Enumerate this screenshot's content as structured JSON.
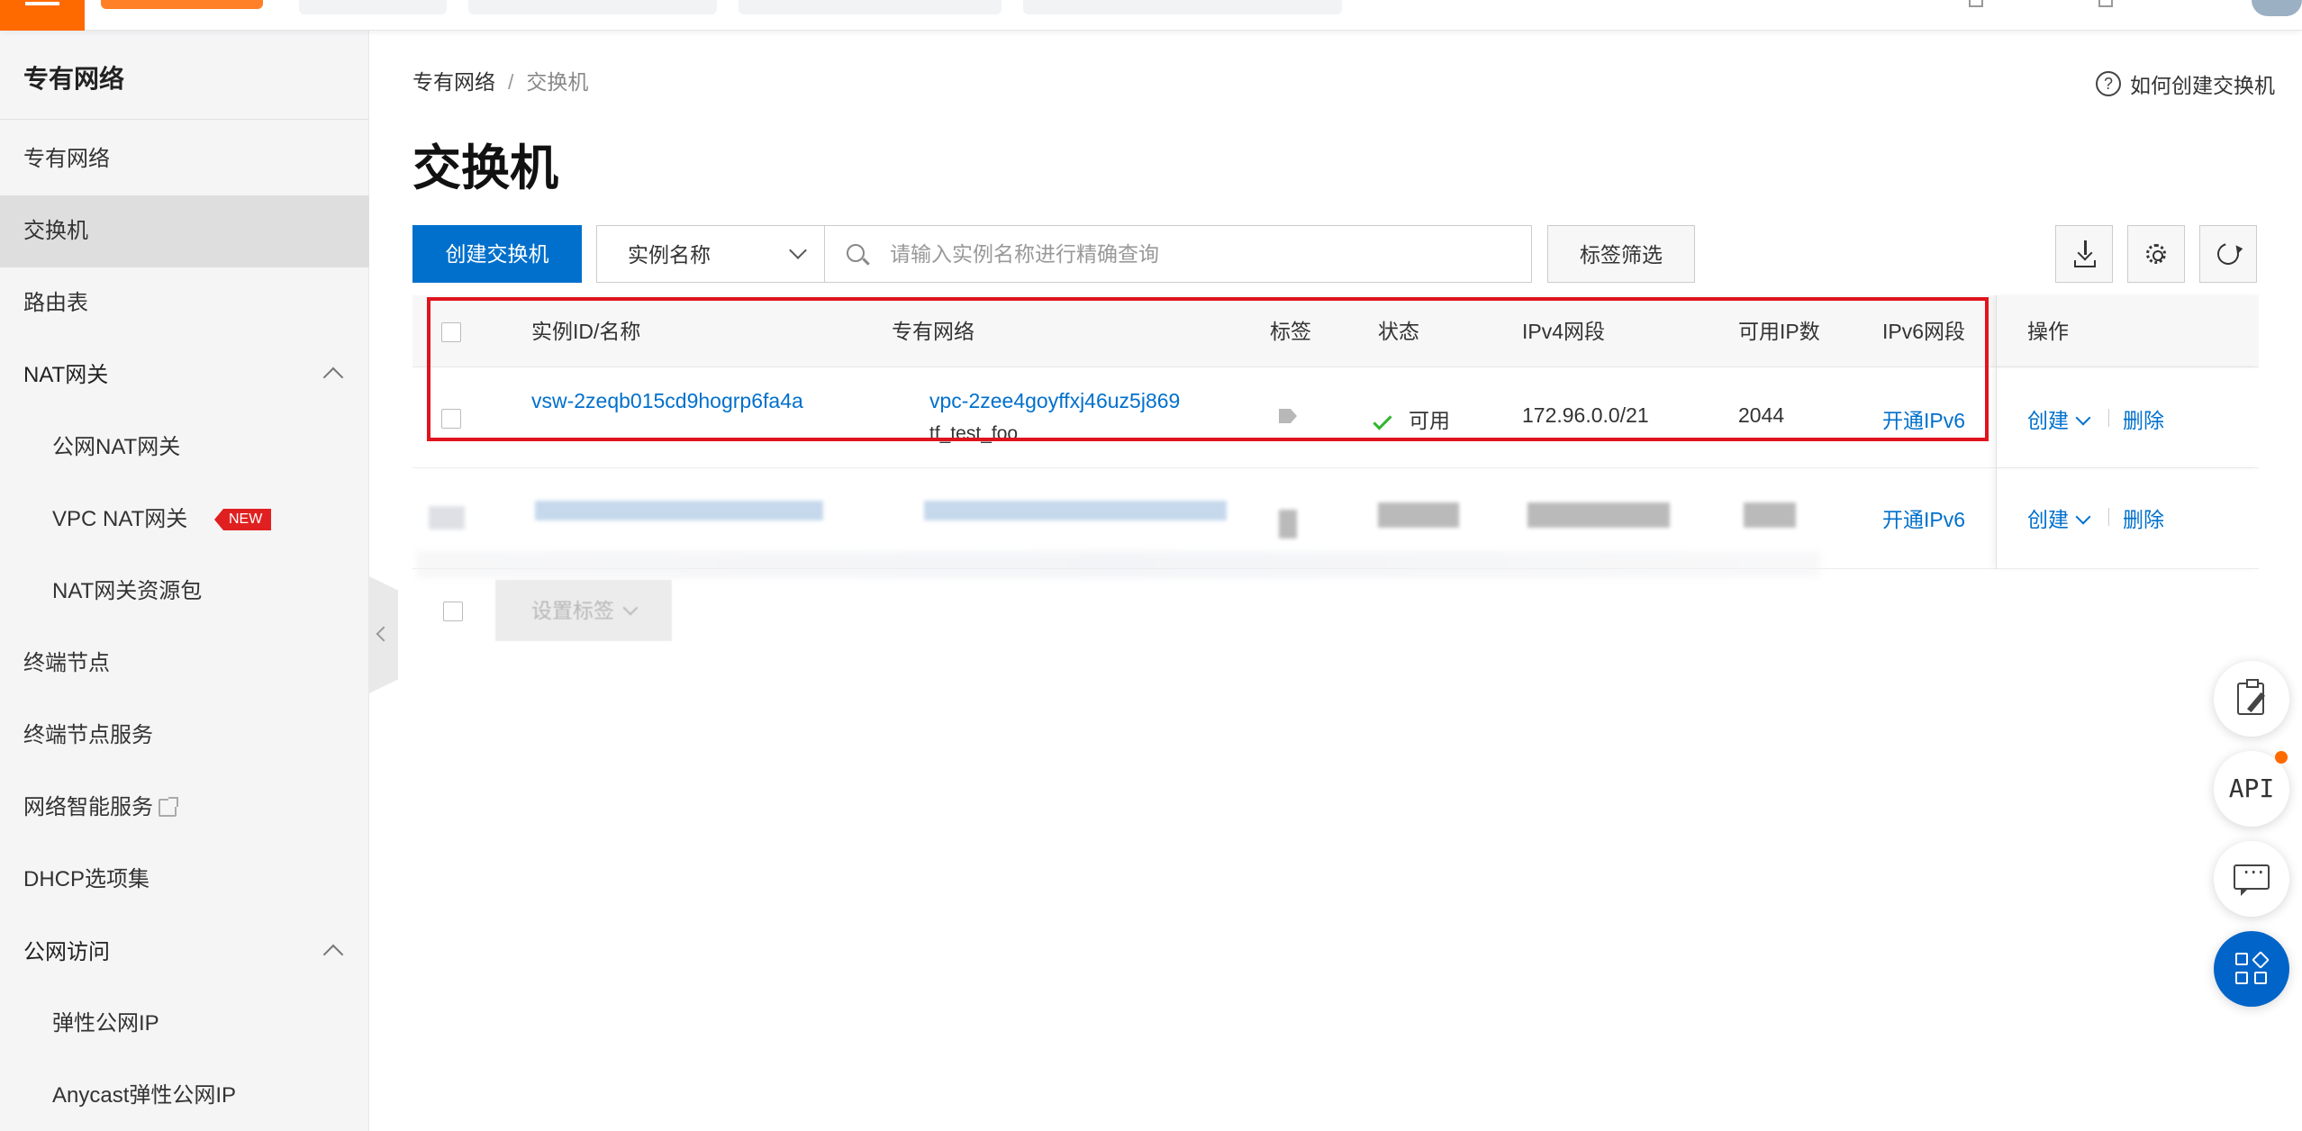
{
  "sidebar": {
    "title": "专有网络",
    "items": [
      {
        "label": "专有网络"
      },
      {
        "label": "交换机"
      },
      {
        "label": "路由表"
      },
      {
        "label": "NAT网关"
      },
      {
        "label": "公网NAT网关"
      },
      {
        "label": "VPC NAT网关",
        "badge": "NEW"
      },
      {
        "label": "NAT网关资源包"
      },
      {
        "label": "终端节点"
      },
      {
        "label": "终端节点服务"
      },
      {
        "label": "网络智能服务"
      },
      {
        "label": "DHCP选项集"
      },
      {
        "label": "公网访问"
      },
      {
        "label": "弹性公网IP"
      },
      {
        "label": "Anycast弹性公网IP"
      }
    ]
  },
  "breadcrumb": {
    "root": "专有网络",
    "sep": "/",
    "current": "交换机"
  },
  "help": {
    "icon": "?",
    "label": "如何创建交换机"
  },
  "page_title": "交换机",
  "toolbar": {
    "create_label": "创建交换机",
    "search_field": "实例名称",
    "search_placeholder": "请输入实例名称进行精确查询",
    "tag_filter_label": "标签筛选"
  },
  "table": {
    "headers": {
      "id_name": "实例ID/名称",
      "vpc": "专有网络",
      "tags": "标签",
      "status": "状态",
      "ipv4": "IPv4网段",
      "available_ip": "可用IP数",
      "ipv6": "IPv6网段",
      "actions": "操作"
    },
    "rows": [
      {
        "id": "vsw-2zeqb015cd9hogrp6fa4a",
        "vpc_id": "vpc-2zee4goyffxj46uz5j869",
        "vpc_name": "tf_test_foo",
        "status": "可用",
        "ipv4": "172.96.0.0/21",
        "available_ip": "2044",
        "ipv6": "开通IPv6",
        "action_create": "创建",
        "action_delete": "删除"
      },
      {
        "ipv6": "开通IPv6",
        "action_create": "创建",
        "action_delete": "删除"
      }
    ],
    "batch_action": "设置标签"
  },
  "floating": {
    "api_label": "API"
  },
  "colors": {
    "primary": "#0070cc",
    "brand": "#ff6a00",
    "highlight": "#e0141e",
    "status_ok": "#2db52d"
  }
}
